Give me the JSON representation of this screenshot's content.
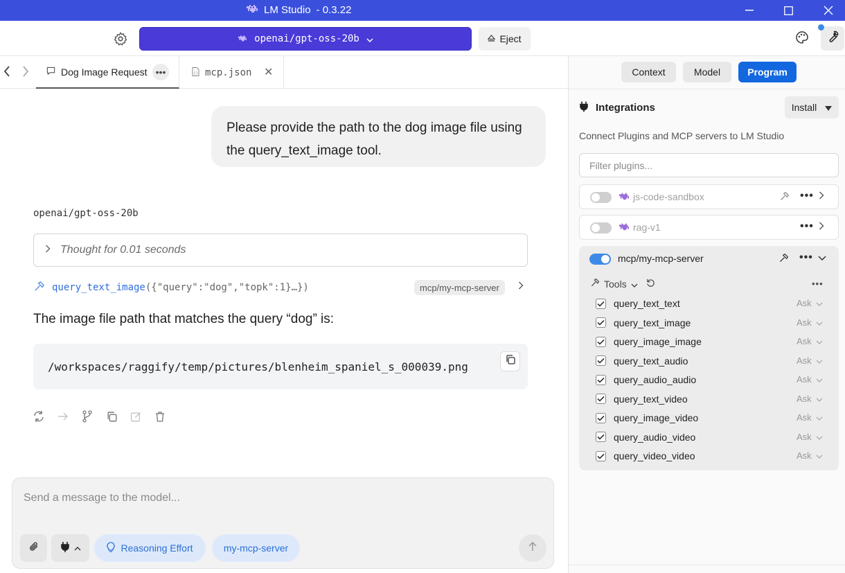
{
  "window": {
    "app_name": "LM Studio",
    "version": "- 0.3.22",
    "minimize_icon": "minimize-icon",
    "maximize_icon": "maximize-icon",
    "close_icon": "close-icon",
    "title_bar_color": "#3a50dc"
  },
  "toolbar": {
    "model_selector_label": "openai/gpt-oss-20b",
    "eject_label": "Eject",
    "accent_color": "#4a3ad8"
  },
  "tabs": [
    {
      "label": "Dog Image Request",
      "active": true
    },
    {
      "label": "mcp.json",
      "active": false
    }
  ],
  "chat": {
    "user_message": "Please provide the path to the dog image file using the query_text_image tool.",
    "model_name": "openai/gpt-oss-20b",
    "thought_label": "Thought for 0.01 seconds",
    "tool_call": {
      "function": "query_text_image",
      "args": "({\"query\":\"dog\",\"topk\":1}…})",
      "server": "mcp/my-mcp-server"
    },
    "answer_text": "The image file path that matches the query “dog” is:",
    "code": "/workspaces/raggify/temp/pictures/blenheim_spaniel_s_000039.png"
  },
  "composer": {
    "placeholder": "Send a message to the model...",
    "reasoning_label": "Reasoning Effort",
    "mcp_label": "my-mcp-server"
  },
  "right_panel": {
    "tabs": {
      "context": "Context",
      "model": "Model",
      "program": "Program"
    },
    "active_tab": "Program",
    "integrations_title": "Integrations",
    "install_label": "Install",
    "description": "Connect Plugins and MCP servers to LM Studio",
    "filter_placeholder": "Filter plugins...",
    "plugins": [
      {
        "name": "js-code-sandbox",
        "enabled": false
      },
      {
        "name": "rag-v1",
        "enabled": false
      }
    ],
    "mcp_server": {
      "name": "mcp/my-mcp-server",
      "enabled": true,
      "tools_label": "Tools",
      "tools": [
        {
          "name": "query_text_text",
          "checked": true,
          "permission": "Ask"
        },
        {
          "name": "query_text_image",
          "checked": true,
          "permission": "Ask"
        },
        {
          "name": "query_image_image",
          "checked": true,
          "permission": "Ask"
        },
        {
          "name": "query_text_audio",
          "checked": true,
          "permission": "Ask"
        },
        {
          "name": "query_audio_audio",
          "checked": true,
          "permission": "Ask"
        },
        {
          "name": "query_text_video",
          "checked": true,
          "permission": "Ask"
        },
        {
          "name": "query_image_video",
          "checked": true,
          "permission": "Ask"
        },
        {
          "name": "query_audio_video",
          "checked": true,
          "permission": "Ask"
        },
        {
          "name": "query_video_video",
          "checked": true,
          "permission": "Ask"
        }
      ]
    },
    "program_color": "#1368e0"
  }
}
